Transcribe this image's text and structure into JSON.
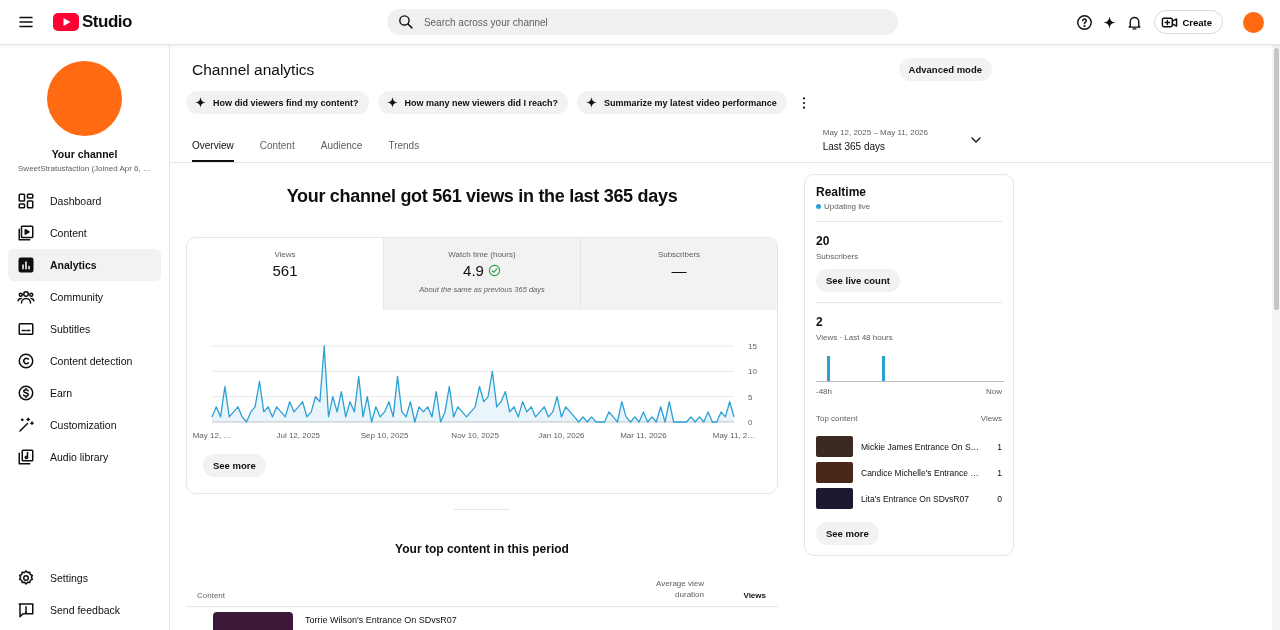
{
  "header": {
    "logo_text": "Studio",
    "search": {
      "placeholder": "Search across your channel"
    },
    "create_label": "Create"
  },
  "sidebar": {
    "channel_title": "Your channel",
    "channel_name": "SweetStratusfaction (Joined Apr 6, …",
    "items": [
      {
        "label": "Dashboard",
        "selected": false
      },
      {
        "label": "Content",
        "selected": false
      },
      {
        "label": "Analytics",
        "selected": true
      },
      {
        "label": "Community",
        "selected": false
      },
      {
        "label": "Subtitles",
        "selected": false
      },
      {
        "label": "Content detection",
        "selected": false
      },
      {
        "label": "Earn",
        "selected": false
      },
      {
        "label": "Customization",
        "selected": false
      },
      {
        "label": "Audio library",
        "selected": false
      }
    ],
    "footer_items": [
      {
        "label": "Settings"
      },
      {
        "label": "Send feedback"
      }
    ]
  },
  "page": {
    "title": "Channel analytics",
    "mode_button": "Advanced mode",
    "prompts": [
      "How did viewers find my content?",
      "How many new viewers did I reach?",
      "Summarize my latest video performance"
    ],
    "tabs": [
      {
        "label": "Overview",
        "selected": true
      },
      {
        "label": "Content",
        "selected": false
      },
      {
        "label": "Audience",
        "selected": false
      },
      {
        "label": "Trends",
        "selected": false
      }
    ],
    "date_range": {
      "dates": "May 12, 2025 – May 11, 2026",
      "label": "Last 365 days"
    }
  },
  "overview": {
    "headline": "Your channel got 561 views in the last 365 days",
    "metrics": [
      {
        "label": "Views",
        "value": "561",
        "selected": true
      },
      {
        "label": "Watch time (hours)",
        "value": "4.9",
        "note": "About the same as previous 365 days",
        "selected": false
      },
      {
        "label": "Subscribers",
        "value": "—",
        "selected": false
      }
    ],
    "chart_data": {
      "type": "area",
      "ylim": [
        0,
        15
      ],
      "yticks": [
        0,
        5,
        10,
        15
      ],
      "categories": [
        "May 12, …",
        null,
        null,
        null,
        null,
        null,
        null,
        null,
        null,
        null,
        null,
        null,
        null,
        null,
        null,
        null,
        null,
        null,
        null,
        null,
        "Jul 12, 2025",
        null,
        null,
        null,
        null,
        null,
        null,
        null,
        null,
        null,
        null,
        null,
        null,
        null,
        null,
        null,
        null,
        null,
        null,
        null,
        "Sep 10, 2025",
        null,
        null,
        null,
        null,
        null,
        null,
        null,
        null,
        null,
        null,
        null,
        null,
        null,
        null,
        null,
        null,
        null,
        null,
        null,
        null,
        "Nov 10, 2025",
        null,
        null,
        null,
        null,
        null,
        null,
        null,
        null,
        null,
        null,
        null,
        null,
        null,
        null,
        null,
        null,
        null,
        null,
        null,
        "Jan 10, 2026",
        null,
        null,
        null,
        null,
        null,
        null,
        null,
        null,
        null,
        null,
        null,
        null,
        null,
        null,
        null,
        null,
        null,
        null,
        "Mar 11, 2026",
        null,
        null,
        null,
        null,
        null,
        null,
        null,
        null,
        null,
        null,
        null,
        null,
        null,
        null,
        null,
        null,
        null,
        null,
        null,
        null,
        "May 11, 2…"
      ],
      "values": [
        1,
        3,
        1,
        7,
        1,
        2,
        3,
        1,
        0,
        2,
        3,
        8,
        2,
        3,
        1,
        3,
        2,
        1,
        4,
        2,
        3,
        4,
        1,
        2,
        5,
        4,
        15,
        1,
        5,
        2,
        6,
        1,
        4,
        2,
        9,
        1,
        5,
        0,
        3,
        1,
        2,
        4,
        1,
        9,
        2,
        1,
        4,
        0,
        3,
        2,
        3,
        1,
        6,
        0,
        2,
        7,
        1,
        3,
        2,
        1,
        2,
        3,
        7,
        4,
        5,
        10,
        3,
        4,
        6,
        2,
        3,
        1,
        4,
        2,
        3,
        1,
        2,
        3,
        1,
        2,
        5,
        1,
        3,
        2,
        1,
        0,
        1,
        0,
        1,
        0,
        0,
        0,
        2,
        1,
        0,
        4,
        1,
        0,
        1,
        0,
        2,
        0,
        1,
        0,
        3,
        0,
        4,
        0,
        0,
        0,
        0,
        1,
        0,
        1,
        0,
        2,
        0,
        0,
        2,
        1,
        4,
        1
      ]
    },
    "see_more": "See more"
  },
  "realtime": {
    "title": "Realtime",
    "status": "Updating live",
    "subscribers": {
      "value": "20",
      "label": "Subscribers",
      "button": "See live count"
    },
    "views": {
      "value": "2",
      "label": "Views · Last 48 hours",
      "start_label": "-48h",
      "end_label": "Now"
    },
    "top_content": {
      "columns": [
        "Top content",
        "Views"
      ],
      "rows": [
        {
          "title": "Mickie James Entrance On S…",
          "views": "1"
        },
        {
          "title": "Candice Michelle's Entrance …",
          "views": "1"
        },
        {
          "title": "Lita's Entrance On SDvsR07",
          "views": "0"
        }
      ]
    },
    "see_more": "See more"
  },
  "top_content": {
    "title": "Your top content in this period",
    "columns": [
      "Content",
      "Average view duration",
      "Views"
    ],
    "rows": [
      {
        "title": "Torrie Wilson's Entrance On SDvsR07"
      }
    ]
  }
}
